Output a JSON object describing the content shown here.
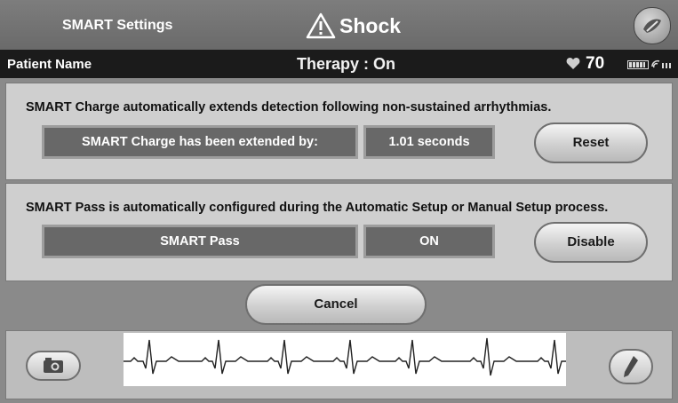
{
  "topbar": {
    "title": "SMART Settings",
    "shock_label": "Shock"
  },
  "status": {
    "patient_name": "Patient Name",
    "therapy": "Therapy : On",
    "heart_rate": "70"
  },
  "smart_charge": {
    "description": "SMART Charge automatically extends detection following non-sustained arrhythmias.",
    "field_label": "SMART Charge has been extended by:",
    "field_value": "1.01 seconds",
    "button_label": "Reset"
  },
  "smart_pass": {
    "description": "SMART Pass is automatically configured during the Automatic Setup or Manual Setup process.",
    "field_label": "SMART Pass",
    "field_value": "ON",
    "button_label": "Disable"
  },
  "footer": {
    "cancel_label": "Cancel"
  },
  "icons": {
    "warning": "warning-triangle-icon",
    "wand": "wand-icon",
    "heart": "heart-icon",
    "battery": "battery-icon",
    "telemetry": "telemetry-signal-icon",
    "camera": "camera-icon",
    "pen": "pen-icon"
  }
}
